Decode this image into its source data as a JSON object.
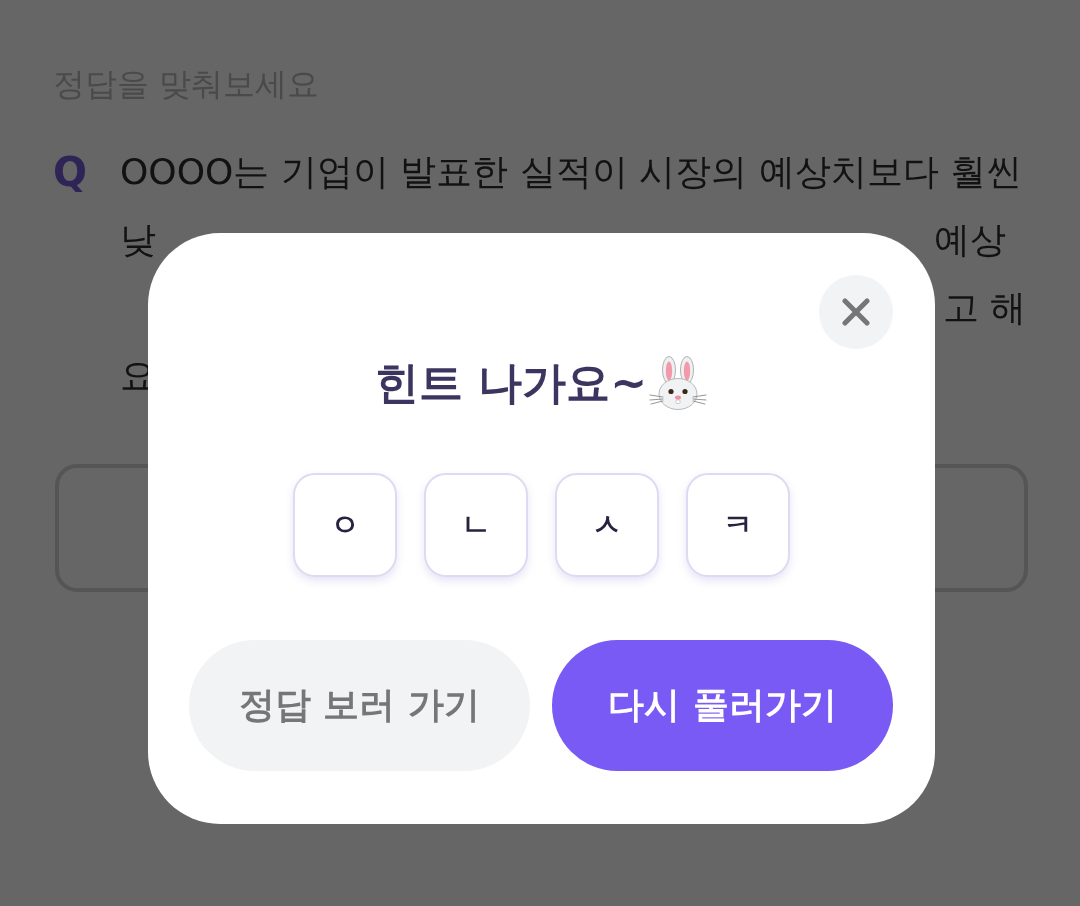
{
  "page": {
    "heading": "정답을 맞춰보세요",
    "question": {
      "marker": "Q",
      "lines": [
        [
          "OOOO는 기업이 발표한 실적이 시장의 예상치보다 훨씬"
        ],
        [
          "낮",
          "예상"
        ],
        [
          "고 해"
        ],
        [
          "요"
        ]
      ]
    }
  },
  "hint_dialog": {
    "title": "힌트 나가요~",
    "hint_letters": [
      "ㅇ",
      "ㄴ",
      "ㅅ",
      "ㅋ"
    ],
    "buttons": [
      {
        "label": "정답 보러 가기",
        "kind": "secondary"
      },
      {
        "label": "다시 풀러가기",
        "kind": "primary"
      }
    ]
  }
}
